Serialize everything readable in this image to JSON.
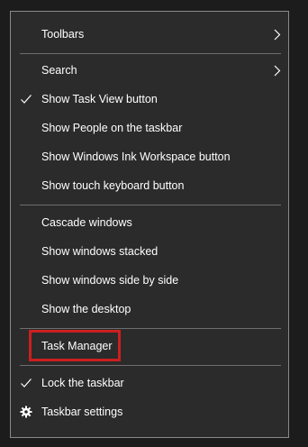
{
  "menu": {
    "items": [
      {
        "label": "Toolbars"
      },
      {
        "label": "Search"
      },
      {
        "label": "Show Task View button"
      },
      {
        "label": "Show People on the taskbar"
      },
      {
        "label": "Show Windows Ink Workspace button"
      },
      {
        "label": "Show touch keyboard button"
      },
      {
        "label": "Cascade windows"
      },
      {
        "label": "Show windows stacked"
      },
      {
        "label": "Show windows side by side"
      },
      {
        "label": "Show the desktop"
      },
      {
        "label": "Task Manager"
      },
      {
        "label": "Lock the taskbar"
      },
      {
        "label": "Taskbar settings"
      }
    ]
  },
  "icons": {
    "submenu": "chevron-right-icon",
    "checked": "checkmark-icon",
    "settings": "gear-icon"
  },
  "colors": {
    "menu_background": "#2b2b2b",
    "menu_border": "#8a8a8a",
    "text": "#ffffff",
    "highlight_box": "#cc1f1f"
  }
}
